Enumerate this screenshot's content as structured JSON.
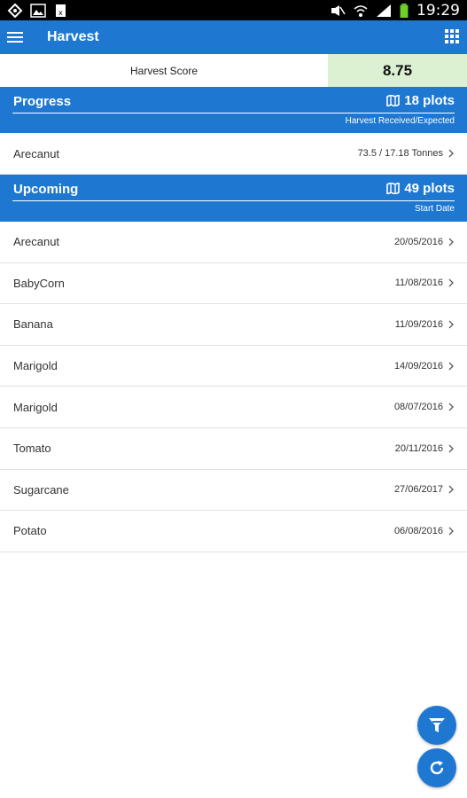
{
  "status_bar": {
    "time": "19:29"
  },
  "app_bar": {
    "title": "Harvest"
  },
  "score": {
    "label": "Harvest Score",
    "value": "8.75",
    "highlight_color": "#dcf0d2"
  },
  "progress": {
    "title": "Progress",
    "count": "18 plots",
    "subtitle": "Harvest Received/Expected",
    "items": [
      {
        "name": "Arecanut",
        "value": "73.5 / 17.18 Tonnes"
      }
    ]
  },
  "upcoming": {
    "title": "Upcoming",
    "count": "49 plots",
    "subtitle": "Start Date",
    "items": [
      {
        "name": "Arecanut",
        "date": "20/05/2016"
      },
      {
        "name": "BabyCorn",
        "date": "11/08/2016"
      },
      {
        "name": "Banana",
        "date": "11/09/2016"
      },
      {
        "name": "Marigold",
        "date": "14/09/2016"
      },
      {
        "name": "Marigold",
        "date": "08/07/2016"
      },
      {
        "name": "Tomato",
        "date": "20/11/2016"
      },
      {
        "name": "Sugarcane",
        "date": "27/06/2017"
      },
      {
        "name": "Potato",
        "date": "06/08/2016"
      }
    ]
  },
  "fabs": {
    "filter_icon": "filter-icon",
    "refresh_icon": "refresh-icon"
  },
  "colors": {
    "primary": "#1e78d2",
    "status_bar": "#000000"
  }
}
